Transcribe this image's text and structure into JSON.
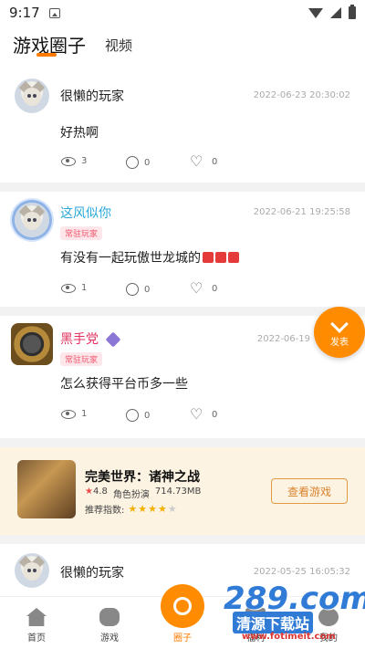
{
  "status": {
    "time": "9:17"
  },
  "header": {
    "tab_main": "游戏圈子",
    "tab_video": "视频"
  },
  "posts": [
    {
      "username": "很懒的玩家",
      "date": "2022-06-23 20:30:02",
      "content": "好热啊",
      "views": "3",
      "comments": "0",
      "likes": "0",
      "tag": ""
    },
    {
      "username": "这风似你",
      "date": "2022-06-21 19:25:58",
      "content": "有没有一起玩傲世龙城的",
      "views": "1",
      "comments": "0",
      "likes": "0",
      "tag": "常驻玩家"
    },
    {
      "username": "黑手党",
      "date": "2022-06-19",
      "content": "怎么获得平台币多一些",
      "views": "1",
      "comments": "0",
      "likes": "0",
      "tag": "常驻玩家"
    },
    {
      "username": "很懒的玩家",
      "date": "2022-05-25 16:05:32",
      "content": "",
      "views": "",
      "comments": "",
      "likes": "",
      "tag": ""
    }
  ],
  "game": {
    "title": "完美世界：诸神之战",
    "rating": "4.8",
    "genre": "角色扮演",
    "size": "714.73MB",
    "recommend_label": "推荐指数:",
    "recommend_stars": 4,
    "button": "查看游戏"
  },
  "fab": {
    "label": "发表"
  },
  "nav": {
    "home": "首页",
    "games": "游戏",
    "circle": "圈子",
    "welfare": "福利",
    "mine": "我的"
  },
  "watermark": {
    "big": "289.com",
    "dl": "清源下载站",
    "url": "www.fotimeit.com"
  },
  "colors": {
    "accent": "#ff8c00",
    "tag": "#f0566e"
  }
}
